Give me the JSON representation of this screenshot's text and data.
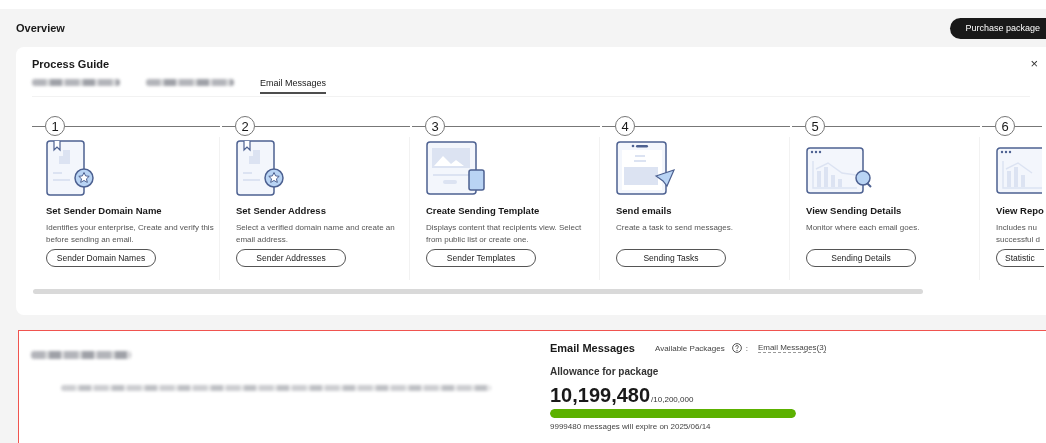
{
  "header": {
    "title": "Overview",
    "action": "Purchase package"
  },
  "process_guide": {
    "title": "Process Guide",
    "close": "×",
    "tabs": [
      {
        "kind": "blurred",
        "selected": false
      },
      {
        "kind": "blurred",
        "selected": false
      },
      {
        "kind": "text",
        "label": "Email Messages",
        "selected": true
      }
    ],
    "steps": [
      {
        "number": "1",
        "kind": "domain",
        "title": "Set Sender Domain Name",
        "description": "Identifies your enterprise, Create and verify this before sending an email.",
        "button": "Sender Domain Names"
      },
      {
        "number": "2",
        "kind": "domain",
        "title": "Set Sender Address",
        "description": "Select a verified domain name and create an email address.",
        "button": "Sender Addresses"
      },
      {
        "number": "3",
        "kind": "template",
        "title": "Create Sending Template",
        "description": "Displays content that recipients view. Select from public list or create one.",
        "button": "Sender Templates"
      },
      {
        "number": "4",
        "kind": "send",
        "title": "Send emails",
        "description": "Create a task to send messages.",
        "button": "Sending Tasks"
      },
      {
        "number": "5",
        "kind": "details",
        "title": "View Sending Details",
        "description": "Monitor where each email goes.",
        "button": "Sending Details"
      },
      {
        "number": "6",
        "kind": "report",
        "title": "View Repo",
        "description": "Includes nu successful d",
        "button": "Statistic"
      }
    ]
  },
  "usage_panel": {
    "title": {
      "kind": "blurred"
    },
    "description": {
      "kind": "blurred"
    },
    "section_title": "Email Messages",
    "packages_label": "Available Packages",
    "packages_separator": ":",
    "packages_link": "Email Messages(3)",
    "allowance_label": "Allowance for package",
    "remaining": "10,199,480",
    "total": "/10,200,000",
    "level": 0.99995,
    "expiry_note": "9999480 messages will expire on 2025/06/14"
  }
}
